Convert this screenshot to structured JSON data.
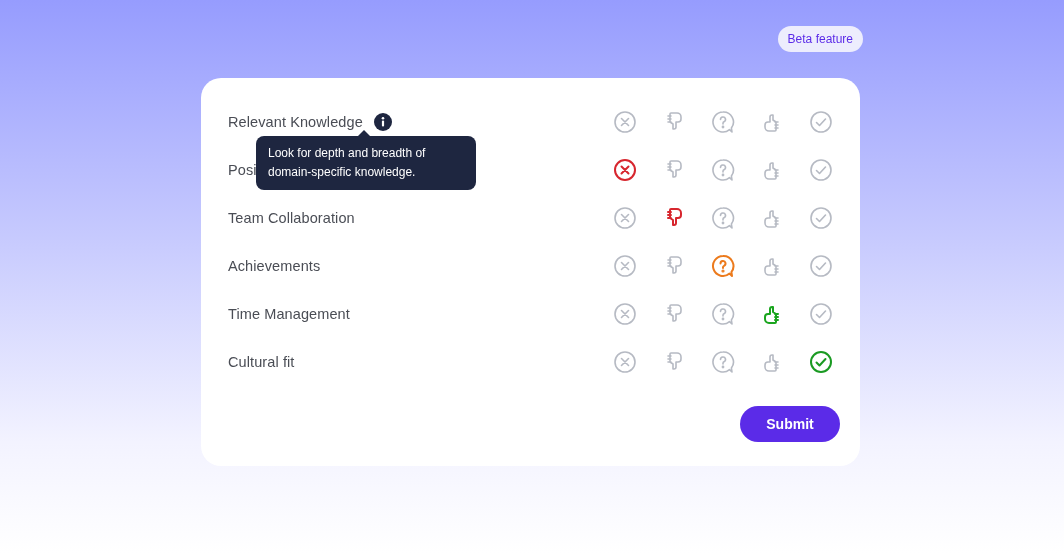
{
  "badge": "Beta feature",
  "rows": [
    {
      "label": "Relevant Knowledge",
      "tooltip": "Look for depth and breadth of domain-specific knowledge.",
      "options": [
        {
          "kind": "reject",
          "selected": false
        },
        {
          "kind": "dislike",
          "selected": false
        },
        {
          "kind": "unsure",
          "selected": false
        },
        {
          "kind": "like",
          "selected": false
        },
        {
          "kind": "approve",
          "selected": false
        }
      ]
    },
    {
      "label": "Posi",
      "options": [
        {
          "kind": "reject",
          "selected": true
        },
        {
          "kind": "dislike",
          "selected": false
        },
        {
          "kind": "unsure",
          "selected": false
        },
        {
          "kind": "like",
          "selected": false
        },
        {
          "kind": "approve",
          "selected": false
        }
      ]
    },
    {
      "label": "Team Collaboration",
      "options": [
        {
          "kind": "reject",
          "selected": false
        },
        {
          "kind": "dislike",
          "selected": true
        },
        {
          "kind": "unsure",
          "selected": false
        },
        {
          "kind": "like",
          "selected": false
        },
        {
          "kind": "approve",
          "selected": false
        }
      ]
    },
    {
      "label": "Achievements",
      "options": [
        {
          "kind": "reject",
          "selected": false
        },
        {
          "kind": "dislike",
          "selected": false
        },
        {
          "kind": "unsure",
          "selected": true
        },
        {
          "kind": "like",
          "selected": false
        },
        {
          "kind": "approve",
          "selected": false
        }
      ]
    },
    {
      "label": "Time Management",
      "options": [
        {
          "kind": "reject",
          "selected": false
        },
        {
          "kind": "dislike",
          "selected": false
        },
        {
          "kind": "unsure",
          "selected": false
        },
        {
          "kind": "like",
          "selected": true
        },
        {
          "kind": "approve",
          "selected": false
        }
      ]
    },
    {
      "label": "Cultural fit",
      "options": [
        {
          "kind": "reject",
          "selected": false
        },
        {
          "kind": "dislike",
          "selected": false
        },
        {
          "kind": "unsure",
          "selected": false
        },
        {
          "kind": "like",
          "selected": false
        },
        {
          "kind": "approve",
          "selected": true
        }
      ]
    }
  ],
  "submit": "Submit"
}
